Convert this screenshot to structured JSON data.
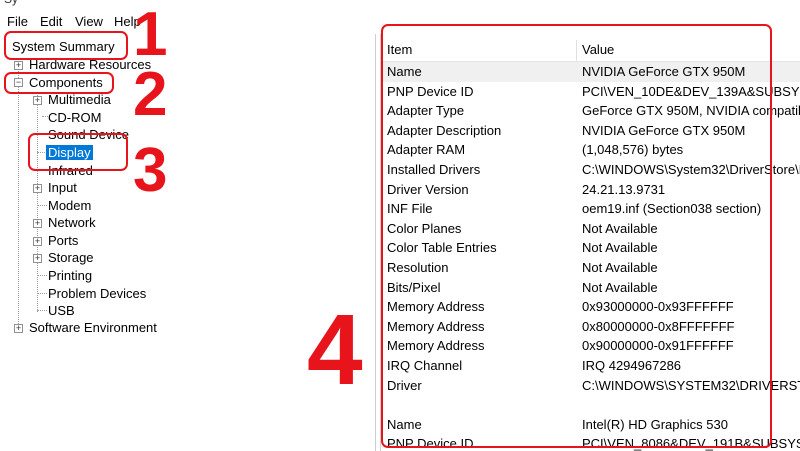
{
  "window": {
    "title_fragment": "Sy"
  },
  "menu": [
    "File",
    "Edit",
    "View",
    "Help"
  ],
  "tree": {
    "system_summary": "System Summary",
    "hardware_resources": "Hardware Resources",
    "components": "Components",
    "children": [
      "Multimedia",
      "CD-ROM",
      "Sound Device",
      "Display",
      "Infrared",
      "Input",
      "Modem",
      "Network",
      "Ports",
      "Storage",
      "Printing",
      "Problem Devices",
      "USB"
    ],
    "selected": "Display",
    "software_environment": "Software Environment"
  },
  "table": {
    "headers": {
      "item": "Item",
      "value": "Value"
    },
    "rows": [
      {
        "item": "Name",
        "value": "NVIDIA GeForce GTX 950M"
      },
      {
        "item": "PNP Device ID",
        "value": "PCI\\VEN_10DE&DEV_139A&SUBSYS"
      },
      {
        "item": "Adapter Type",
        "value": "GeForce GTX 950M, NVIDIA compatible"
      },
      {
        "item": "Adapter Description",
        "value": "NVIDIA GeForce GTX 950M"
      },
      {
        "item": "Adapter RAM",
        "value": "(1,048,576) bytes"
      },
      {
        "item": "Installed Drivers",
        "value": "C:\\WINDOWS\\System32\\DriverStore\\F"
      },
      {
        "item": "Driver Version",
        "value": "24.21.13.9731"
      },
      {
        "item": "INF File",
        "value": "oem19.inf (Section038 section)"
      },
      {
        "item": "Color Planes",
        "value": "Not Available"
      },
      {
        "item": "Color Table Entries",
        "value": "Not Available"
      },
      {
        "item": "Resolution",
        "value": "Not Available"
      },
      {
        "item": "Bits/Pixel",
        "value": "Not Available"
      },
      {
        "item": "Memory Address",
        "value": "0x93000000-0x93FFFFFF"
      },
      {
        "item": "Memory Address",
        "value": "0x80000000-0x8FFFFFFF"
      },
      {
        "item": "Memory Address",
        "value": "0x90000000-0x91FFFFFF"
      },
      {
        "item": "IRQ Channel",
        "value": "IRQ 4294967286"
      },
      {
        "item": "Driver",
        "value": "C:\\WINDOWS\\SYSTEM32\\DRIVERST"
      },
      {
        "item": "",
        "value": ""
      },
      {
        "item": "Name",
        "value": "Intel(R) HD Graphics 530"
      },
      {
        "item": "PNP Device ID",
        "value": "PCI\\VEN_8086&DEV_191B&SUBSYS"
      }
    ]
  },
  "annotations": [
    "1",
    "2",
    "3",
    "4"
  ],
  "colors": {
    "annotation": "#e8141b",
    "selection": "#0078d7"
  }
}
